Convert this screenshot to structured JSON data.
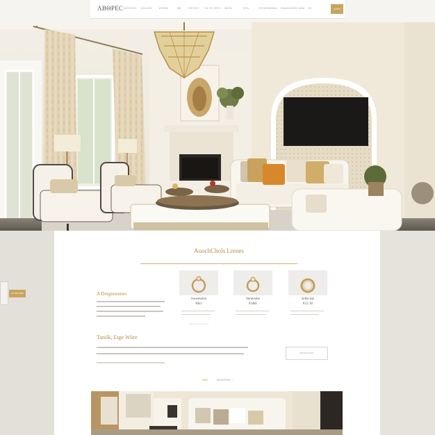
{
  "header": {
    "logo": "ΛΒΘΡΕС",
    "nav": [
      "ΜΟΥΣΕΙΟ",
      "ΚΟΛΛΕΚ",
      "ΑΓΟΡΑ",
      "ΜΕ",
      "ΣΠΙΤΙΟΥ",
      "ΓΙΑ ΤΟ ΣΠΙΤΙ",
      "ΦΩΤΑ",
      "ΕΠΑ",
      "ΕΠΙΚΟΙΝΩΝΙΑ",
      "ΕΚΔΗΛΩΣΕΙΣ ΝΕΑ",
      "ΙΝ"
    ],
    "cta": "ΑΓΟΡΑ"
  },
  "side": {
    "tag": "ΑΓΟΡΑ ΤΩΡΑ"
  },
  "collection": {
    "title": "AuochChols Lrenes",
    "intro_heading": "A Dergnoennes",
    "products": [
      {
        "name": "Sooemsion",
        "price": "€&1"
      },
      {
        "name": "Snnorsme",
        "price": "€1&6"
      },
      {
        "name": "ScRa bas",
        "price": "€12 18"
      }
    ]
  },
  "feature": {
    "heading": "Tanilk, Etge Wiire",
    "button": "ΠΕΡΙΣΣΟΤΕΡΑ"
  },
  "pagination": {
    "active": "ΑΘΗ",
    "next": "ΑΚΟΛΟΥΘΗ →"
  },
  "colors": {
    "accent": "#c8a55e",
    "gold_text": "#b38f45"
  }
}
